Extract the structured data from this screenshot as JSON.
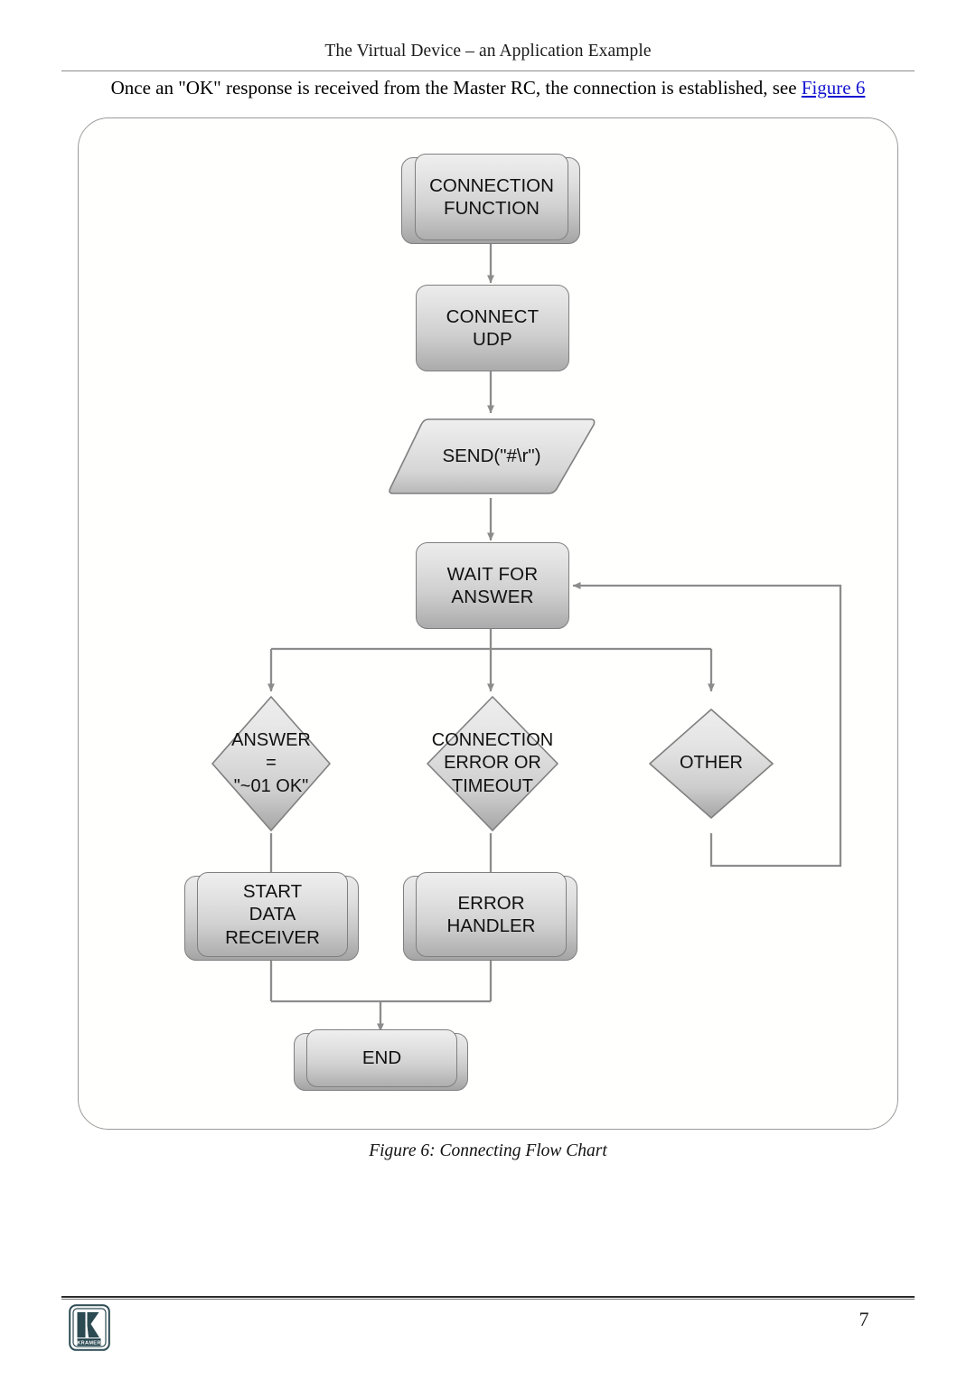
{
  "document": {
    "header_title": "The Virtual Device – an Application Example",
    "page_number": "7",
    "logo_text": "KRAMER"
  },
  "body": {
    "intro_before": "Once an \"OK\" response is received from the Master RC, the connection is established, see ",
    "intro_link": "Figure 6"
  },
  "figure": {
    "caption": "Figure 6: Connecting Flow Chart"
  },
  "chart_data": {
    "type": "diagram",
    "title": "Connecting Flow Chart",
    "nodes": [
      {
        "id": "connection_function",
        "label": "CONNECTION\nFUNCTION",
        "line1": "CONNECTION",
        "line2": "FUNCTION",
        "shape": "predefined-process"
      },
      {
        "id": "connect_udp",
        "label": "CONNECT\nUDP",
        "line1": "CONNECT",
        "line2": "UDP",
        "shape": "process"
      },
      {
        "id": "send_cmd",
        "label": "SEND(\"#\\r\")",
        "shape": "data-parallelogram"
      },
      {
        "id": "wait_for_answer",
        "label": "WAIT FOR\nANSWER",
        "line1": "WAIT FOR",
        "line2": "ANSWER",
        "shape": "process"
      },
      {
        "id": "answer_ok",
        "label": "ANSWER\n=\n\"~01 OK\"",
        "line1": "ANSWER",
        "line2": "=",
        "line3": "\"~01 OK\"",
        "shape": "decision"
      },
      {
        "id": "connection_error",
        "label": "CONNECTION\nERROR OR\nTIMEOUT",
        "line1": "CONNECTION",
        "line2": "ERROR OR",
        "line3": "TIMEOUT",
        "shape": "decision"
      },
      {
        "id": "other",
        "label": "OTHER",
        "line1": "OTHER",
        "shape": "decision"
      },
      {
        "id": "start_data_receiver",
        "label": "START\nDATA\nRECEIVER",
        "line1": "START",
        "line2": "DATA",
        "line3": "RECEIVER",
        "shape": "predefined-process"
      },
      {
        "id": "error_handler",
        "label": "ERROR\nHANDLER",
        "line1": "ERROR",
        "line2": "HANDLER",
        "shape": "predefined-process"
      },
      {
        "id": "end",
        "label": "END",
        "line1": "END",
        "shape": "predefined-process"
      }
    ],
    "edges": [
      {
        "from": "connection_function",
        "to": "connect_udp"
      },
      {
        "from": "connect_udp",
        "to": "send_cmd"
      },
      {
        "from": "send_cmd",
        "to": "wait_for_answer"
      },
      {
        "from": "wait_for_answer",
        "to": "answer_ok"
      },
      {
        "from": "wait_for_answer",
        "to": "connection_error"
      },
      {
        "from": "wait_for_answer",
        "to": "other"
      },
      {
        "from": "answer_ok",
        "to": "start_data_receiver"
      },
      {
        "from": "connection_error",
        "to": "error_handler"
      },
      {
        "from": "other",
        "to": "wait_for_answer",
        "style": "feedback-loop"
      },
      {
        "from": "start_data_receiver",
        "to": "end"
      },
      {
        "from": "error_handler",
        "to": "end"
      }
    ],
    "colors": {
      "node_fill_top": "#ececec",
      "node_fill_bottom": "#ababab",
      "node_border": "#7f7f7f",
      "connector": "#8c8c8c",
      "frame_border": "#9a9a9a",
      "link": "#1414d2",
      "logo": "#2b4a52"
    }
  }
}
